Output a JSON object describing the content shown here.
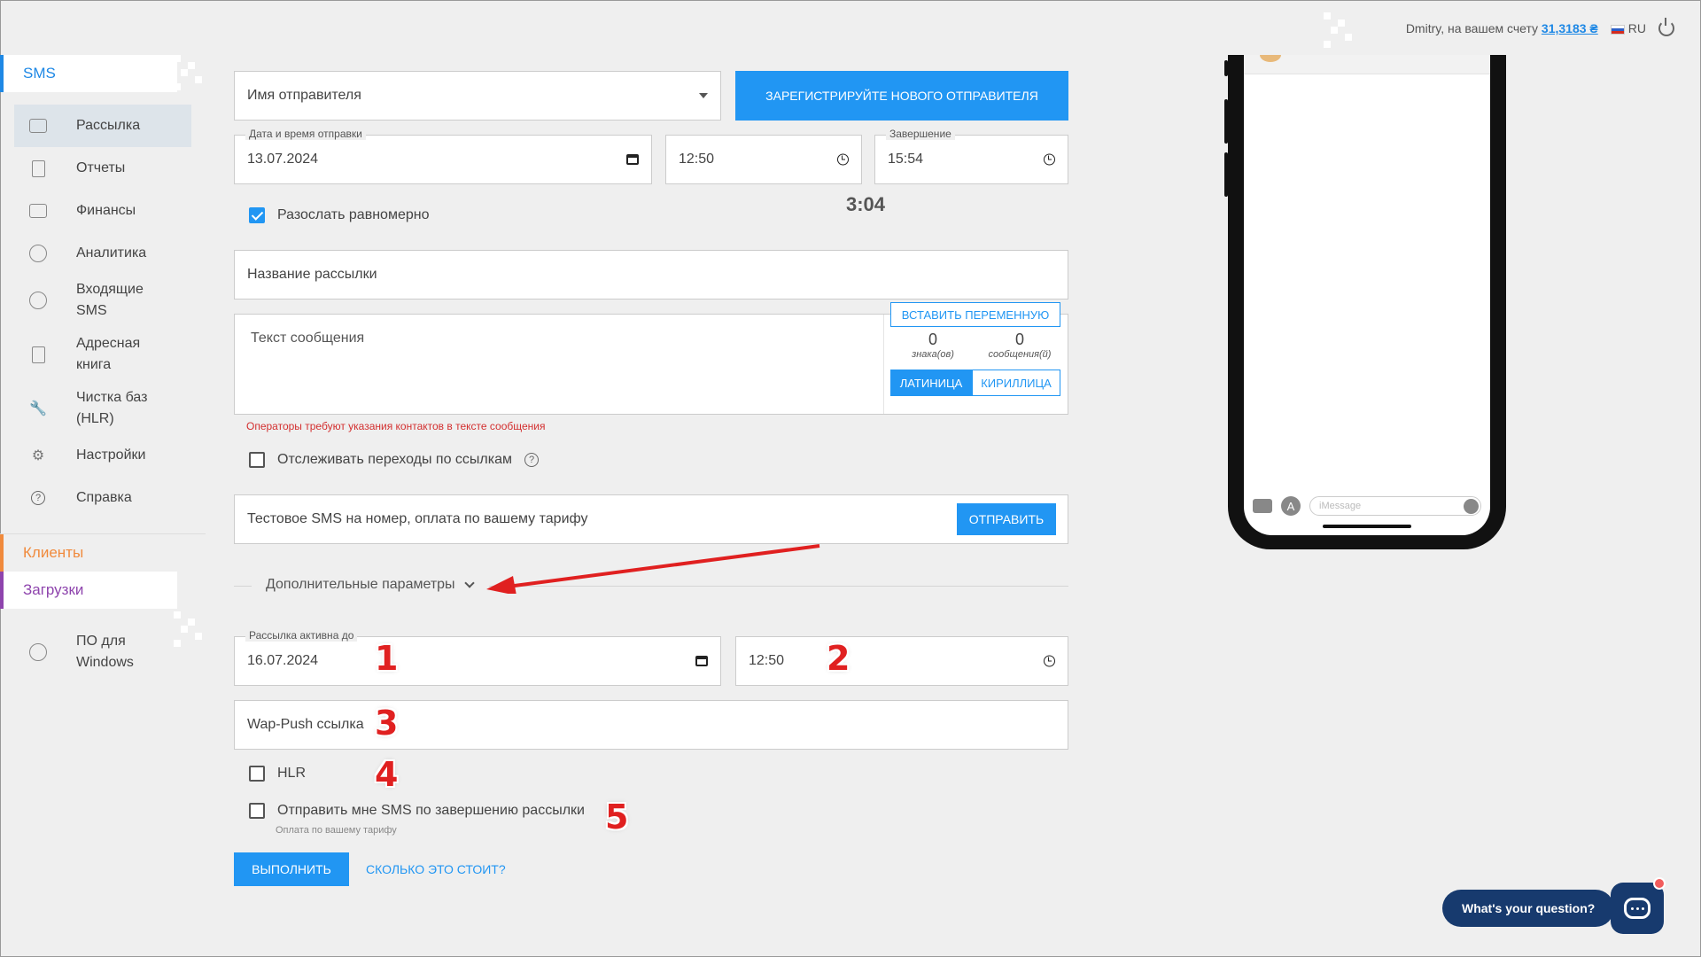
{
  "header": {
    "greeting": "Dmitry, на вашем счету",
    "balance": "31,3183 ₴",
    "lang": "RU"
  },
  "sidebar": {
    "sms": "SMS",
    "items": [
      {
        "label": "Рассылка",
        "icon": "envelope-icon"
      },
      {
        "label": "Отчеты",
        "icon": "document-icon"
      },
      {
        "label": "Финансы",
        "icon": "wallet-icon"
      },
      {
        "label": "Аналитика",
        "icon": "pie-chart-icon"
      },
      {
        "label": "Входящие SMS",
        "icon": "inbox-icon"
      },
      {
        "label": "Адресная книга",
        "icon": "address-book-icon"
      },
      {
        "label": "Чистка баз (HLR)",
        "icon": "wrench-icon"
      },
      {
        "label": "Настройки",
        "icon": "gear-icon"
      },
      {
        "label": "Справка",
        "icon": "help-icon"
      }
    ],
    "clients": "Клиенты",
    "downloads": "Загрузки",
    "windows": "ПО для Windows"
  },
  "form": {
    "sender_placeholder": "Имя отправителя",
    "register_button": "ЗАРЕГИСТРИРУЙТЕ НОВОГО ОТПРАВИТЕЛЯ",
    "date_label": "Дата и время отправки",
    "date_value": "13.07.2024",
    "time_value": "12:50",
    "end_label": "Завершение",
    "end_value": "15:54",
    "duration": "3:04",
    "even_checkbox": "Разослать равномерно",
    "name_placeholder": "Название рассылки",
    "text_placeholder": "Текст сообщения",
    "insert_var": "ВСТАВИТЬ ПЕРЕМЕННУЮ",
    "chars_count": "0",
    "chars_label": "знака(ов)",
    "msgs_count": "0",
    "msgs_label": "сообщения(й)",
    "latin": "ЛАТИНИЦА",
    "cyrillic": "КИРИЛЛИЦА",
    "warning": "Операторы требуют указания контактов в тексте сообщения",
    "track_links": "Отслеживать переходы по ссылкам",
    "test_sms_placeholder": "Тестовое SMS на номер, оплата по вашему тарифу",
    "send_button": "ОТПРАВИТЬ",
    "extra_params": "Дополнительные параметры",
    "active_until_label": "Рассылка активна до",
    "active_until_date": "16.07.2024",
    "active_until_time": "12:50",
    "wap_push": "Wap-Push ссылка",
    "hlr": "HLR",
    "notify_sms": "Отправить мне SMS по завершению рассылки",
    "notify_note": "Оплата по вашему тарифу",
    "execute": "ВЫПОЛНИТЬ",
    "cost_link": "СКОЛЬКО ЭТО СТОИТ?"
  },
  "annotations": [
    "1",
    "2",
    "3",
    "4",
    "5"
  ],
  "phone": {
    "imessage_placeholder": "iMessage"
  },
  "chat": {
    "question": "What's your question?"
  },
  "colors": {
    "accent": "#2196f3",
    "clients": "#f08a3c",
    "downloads": "#8e44ad",
    "annotation": "#e02020",
    "chat": "#173a6e"
  }
}
